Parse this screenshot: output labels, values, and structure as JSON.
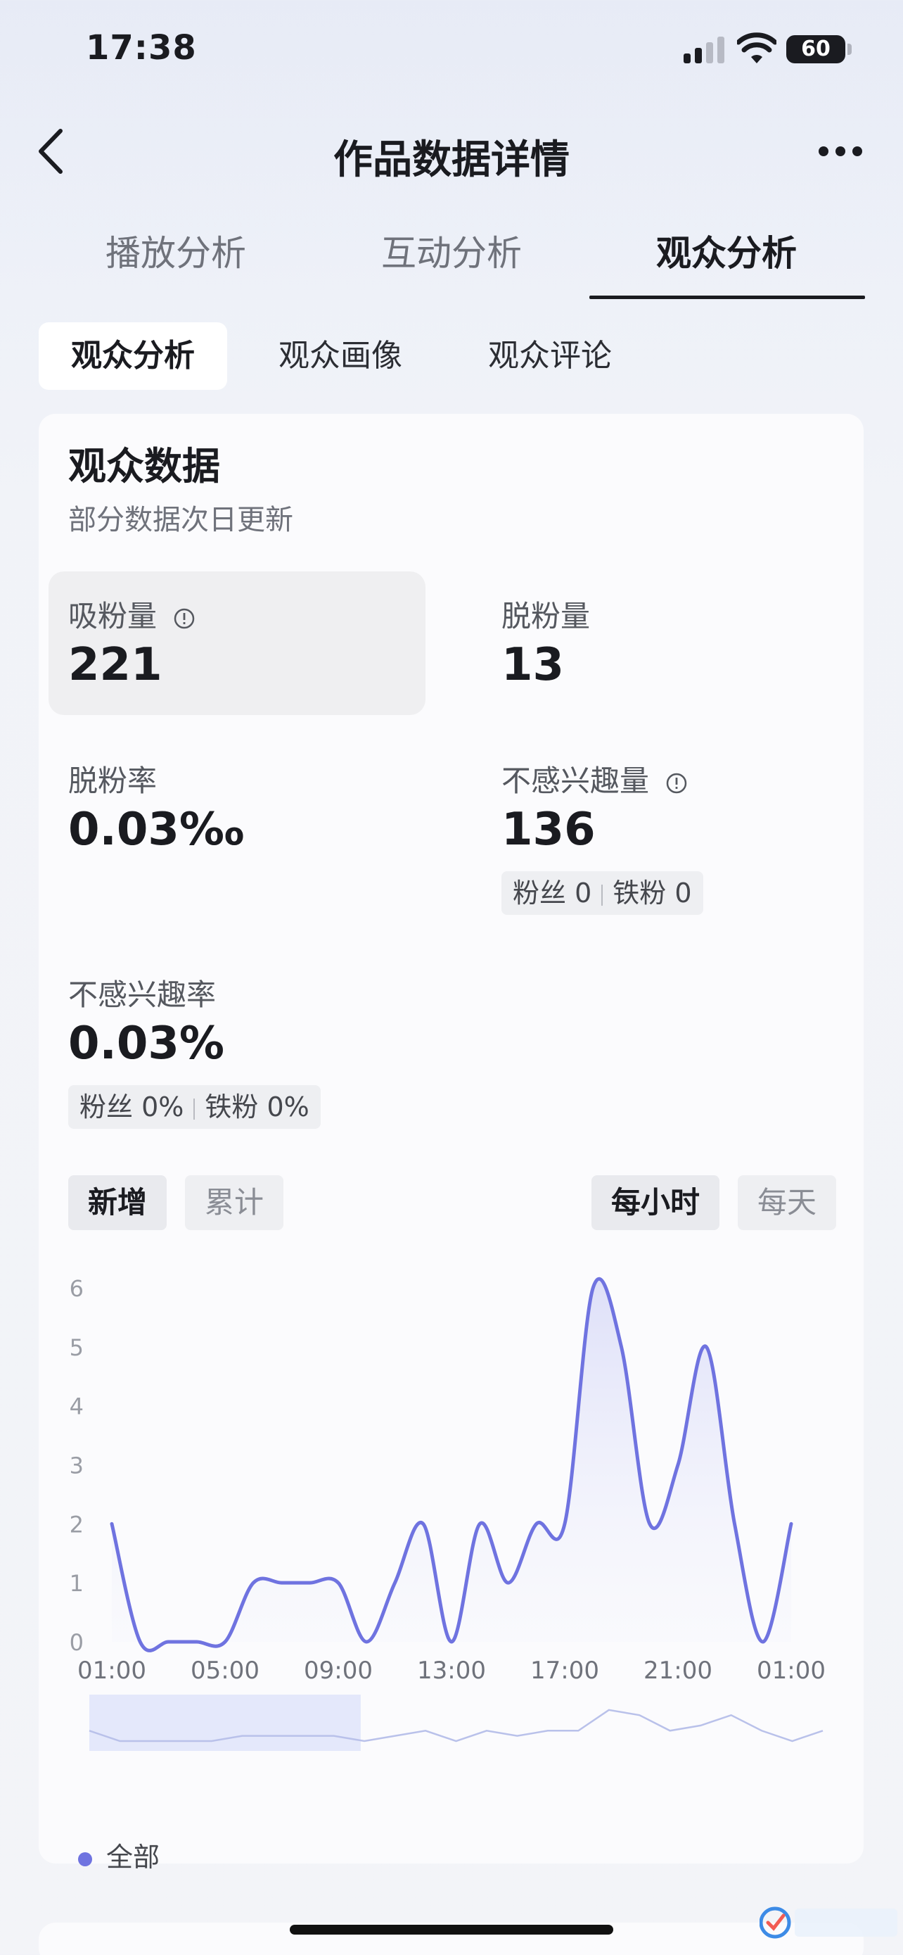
{
  "status_bar": {
    "time": "17:38",
    "battery": "60"
  },
  "nav": {
    "title": "作品数据详情"
  },
  "main_tabs": [
    {
      "label": "播放分析",
      "active": false
    },
    {
      "label": "互动分析",
      "active": false
    },
    {
      "label": "观众分析",
      "active": true
    }
  ],
  "sub_tabs": [
    {
      "label": "观众分析",
      "active": true
    },
    {
      "label": "观众画像",
      "active": false
    },
    {
      "label": "观众评论",
      "active": false
    }
  ],
  "audience_data": {
    "title": "观众数据",
    "subtitle": "部分数据次日更新",
    "metrics": {
      "gain_fans": {
        "label": "吸粉量",
        "value": "221"
      },
      "lost_fans": {
        "label": "脱粉量",
        "value": "13"
      },
      "lost_rate": {
        "label": "脱粉率",
        "value": "0.03‰"
      },
      "not_interested": {
        "label": "不感兴趣量",
        "value": "136",
        "fans": "粉丝 0",
        "iron_fans": "铁粉 0"
      },
      "not_interested_rate": {
        "label": "不感兴趣率",
        "value": "0.03%",
        "fans": "粉丝 0%",
        "iron_fans": "铁粉 0%"
      }
    }
  },
  "chart_controls": {
    "mode": [
      {
        "label": "新增",
        "active": true
      },
      {
        "label": "累计",
        "active": false
      }
    ],
    "granularity": [
      {
        "label": "每小时",
        "active": true
      },
      {
        "label": "每天",
        "active": false
      }
    ]
  },
  "legend": {
    "label": "全部"
  },
  "colors": {
    "series": "#6f73e0",
    "fill": "#e9eafb"
  },
  "chart_data": {
    "type": "area",
    "x": [
      "01:00",
      "02:00",
      "03:00",
      "04:00",
      "05:00",
      "06:00",
      "07:00",
      "08:00",
      "09:00",
      "10:00",
      "11:00",
      "12:00",
      "13:00",
      "14:00",
      "15:00",
      "16:00",
      "17:00",
      "18:00",
      "19:00",
      "20:00",
      "21:00",
      "22:00",
      "23:00",
      "00:00",
      "01:00"
    ],
    "x_tick_labels": [
      "01:00",
      "05:00",
      "09:00",
      "13:00",
      "17:00",
      "21:00",
      "01:00"
    ],
    "y_ticks": [
      0,
      1,
      2,
      3,
      4,
      5,
      6
    ],
    "ylim": [
      0,
      6
    ],
    "series": [
      {
        "name": "全部",
        "values": [
          2,
          0,
          0,
          0,
          0,
          1,
          1,
          1,
          1,
          0,
          1,
          2,
          0,
          2,
          1,
          2,
          2,
          6,
          5,
          2,
          3,
          5,
          2,
          0,
          2
        ]
      }
    ],
    "grid": false,
    "legend_position": "bottom-left"
  }
}
